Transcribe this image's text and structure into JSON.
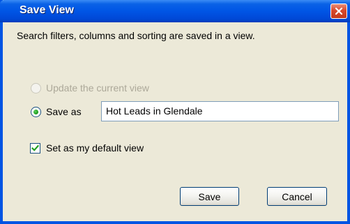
{
  "window": {
    "title": "Save View"
  },
  "dialog": {
    "description": "Search filters, columns and sorting are saved in a view.",
    "options": {
      "update_label": "Update the current view",
      "update_enabled": false,
      "save_as_label": "Save as",
      "save_as_selected": true,
      "view_name": "Hot Leads in Glendale"
    },
    "default_view": {
      "label": "Set as my default view",
      "checked": true
    },
    "buttons": {
      "save": "Save",
      "cancel": "Cancel"
    }
  },
  "colors": {
    "titlebar": "#0055e5",
    "close": "#d8482b",
    "dialog_bg": "#ece9d8",
    "radio_dot": "#21a121",
    "checkmark": "#21a121"
  },
  "icons": {
    "close": "close-icon",
    "check": "checkmark-icon"
  }
}
